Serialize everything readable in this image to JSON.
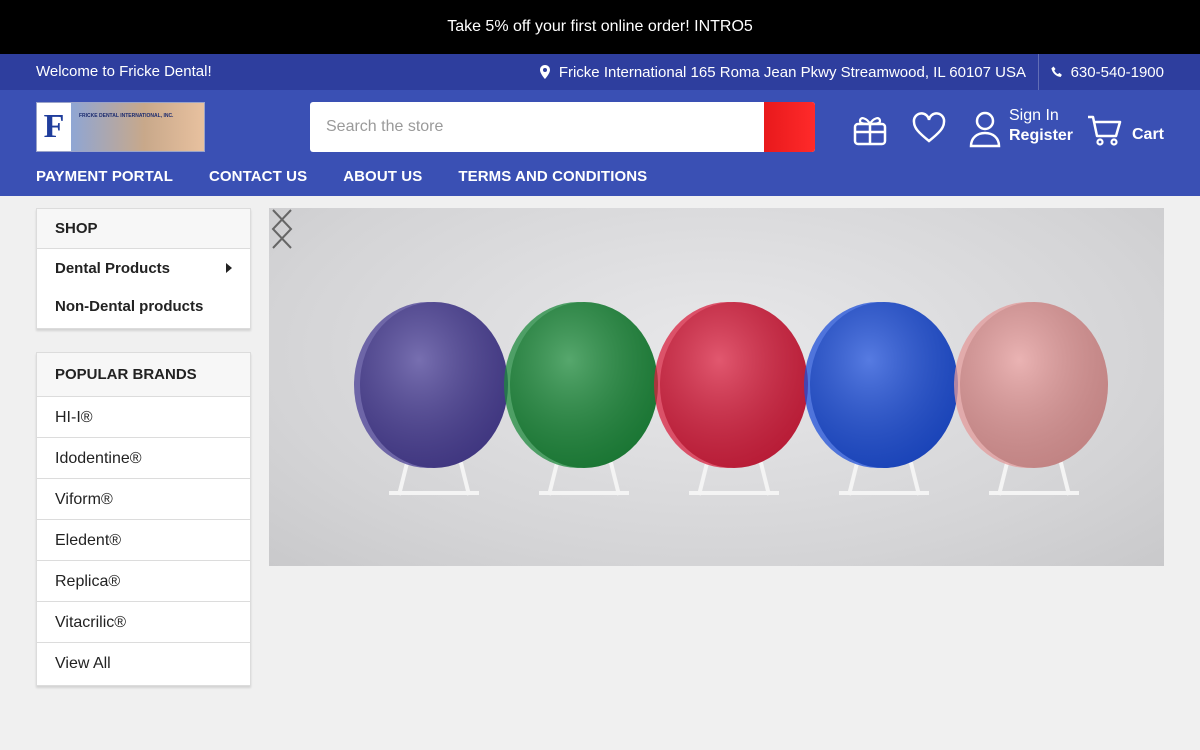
{
  "promo": {
    "text": "Take 5% off your first online order!  INTRO5"
  },
  "topbar": {
    "welcome": "Welcome to Fricke Dental!",
    "address": "Fricke International 165 Roma Jean Pkwy Streamwood, IL 60107 USA",
    "phone": "630-540-1900"
  },
  "header": {
    "logo_letter": "F",
    "logo_subtext": "FRICKE DENTAL INTERNATIONAL, INC.",
    "search_placeholder": "Search the store",
    "signin_label": "Sign In",
    "register_label": "Register",
    "cart_label": "Cart"
  },
  "nav": [
    "PAYMENT PORTAL",
    "CONTACT US",
    "ABOUT US",
    "TERMS AND CONDITIONS"
  ],
  "shop": {
    "title": "SHOP",
    "items": [
      "Dental Products",
      "Non-Dental products"
    ]
  },
  "brands": {
    "title": "POPULAR BRANDS",
    "items": [
      "HI-I®",
      "Idodentine®",
      "Viform®",
      "Eledent®",
      "Replica®",
      "Vitacrilic®",
      "View All"
    ]
  },
  "hero": {
    "disc_colors": [
      "#4a3f96",
      "#1e8a3c",
      "#d8203f",
      "#1e4fd8",
      "#e39a9a"
    ]
  },
  "icons": {
    "pin": "map-pin-icon",
    "phone": "phone-icon",
    "gift": "gift-icon",
    "heart": "heart-icon",
    "user": "user-icon",
    "cart": "cart-icon"
  }
}
